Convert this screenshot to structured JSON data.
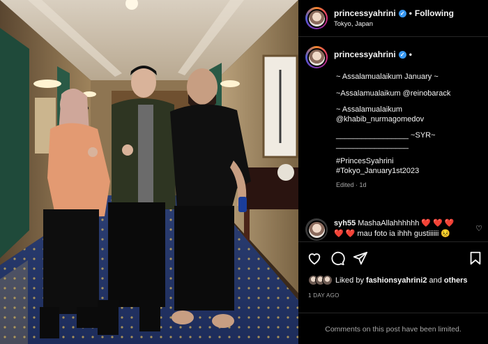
{
  "post": {
    "photo_alt": "",
    "colors": {
      "background": "#000000",
      "verified": "#3897f0",
      "muted": "#a8a8a8",
      "heart": "#ed4956"
    }
  },
  "header": {
    "username": "princessyahrini",
    "verified_icon": "verified-badge-icon",
    "separator": "•",
    "follow_status": "Following",
    "location": "Tokyo, Japan"
  },
  "caption": {
    "username": "princessyahrini",
    "separator": "•",
    "lines": [
      "~ Assalamualaikum January ~",
      "~Assalamualaikum @reinobarack",
      "~ Assalamualaikum",
      "@khabib_nurmagomedov",
      "_________________ ~SYR~",
      "_________________",
      "#PrincesSyahrini",
      "#Tokyo_January1st2023"
    ],
    "edited": "Edited · 1d"
  },
  "comment": {
    "username": "syh55",
    "text_line1": "MashaAllahhhhhh ❤️ ❤️ ❤️",
    "text_line2": "❤️ ❤️ mau foto ia ihhh gustiiiiii 😣",
    "like_icon": "heart-outline-icon"
  },
  "actions": {
    "like_icon": "heart-outline-icon",
    "comment_icon": "comment-bubble-icon",
    "share_icon": "paper-plane-icon",
    "save_icon": "bookmark-icon"
  },
  "likes": {
    "prefix": "Liked by ",
    "user": "fashionsyahrini2",
    "suffix": " and ",
    "others": "others"
  },
  "date": "1 DAY AGO",
  "footer": {
    "limited_text": "Comments on this post have been limited."
  }
}
